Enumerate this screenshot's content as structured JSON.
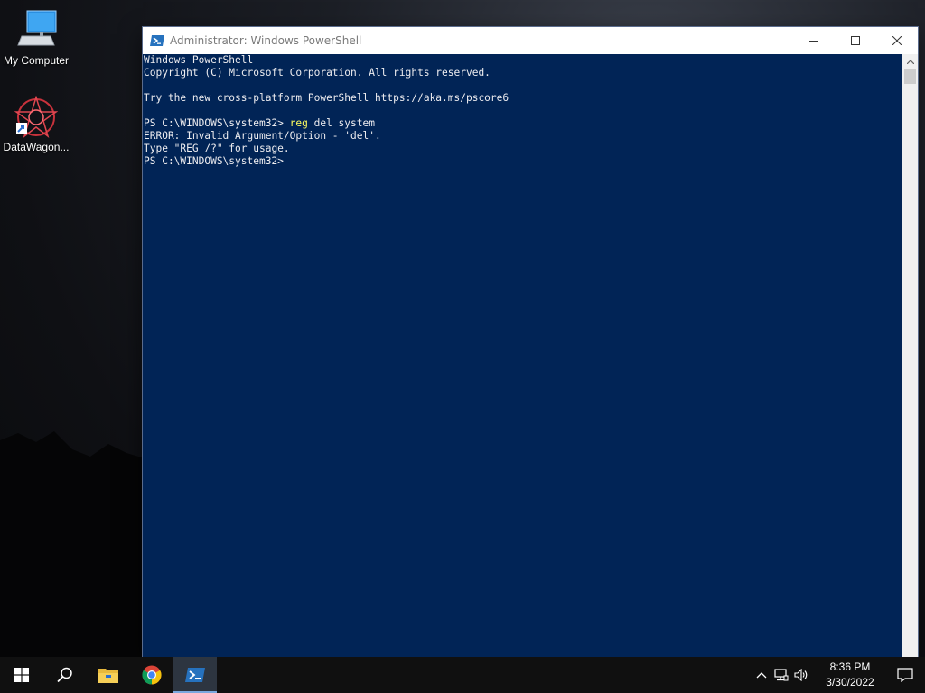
{
  "desktop": {
    "icons": [
      {
        "label": "My Computer",
        "icon": "computer-icon"
      },
      {
        "label": "DataWagon...",
        "icon": "datawagon-icon"
      }
    ]
  },
  "window": {
    "title": "Administrator: Windows PowerShell",
    "app_icon": "powershell-icon",
    "background_color": "#012456",
    "text_color": "#eeedf0",
    "keyword_color": "#fdfd5f"
  },
  "console": {
    "lines": [
      {
        "text": "Windows PowerShell"
      },
      {
        "text": "Copyright (C) Microsoft Corporation. All rights reserved."
      },
      {
        "text": ""
      },
      {
        "text": "Try the new cross-platform PowerShell https://aka.ms/pscore6"
      },
      {
        "text": ""
      },
      {
        "prompt": "PS C:\\WINDOWS\\system32> ",
        "command": "reg",
        "rest": " del system"
      },
      {
        "text": "ERROR: Invalid Argument/Option - 'del'."
      },
      {
        "text": "Type \"REG /?\" for usage."
      },
      {
        "prompt": "PS C:\\WINDOWS\\system32> ",
        "command": "",
        "rest": ""
      }
    ]
  },
  "taskbar": {
    "buttons": [
      "start-icon",
      "search-icon",
      "file-explorer-icon",
      "chrome-icon",
      "powershell-icon"
    ],
    "active": "powershell-icon",
    "tray_icons": [
      "chevron-up-icon",
      "network-icon",
      "volume-icon"
    ],
    "clock": {
      "time": "8:36 PM",
      "date": "3/30/2022"
    },
    "notification_icon": "notification-icon"
  }
}
